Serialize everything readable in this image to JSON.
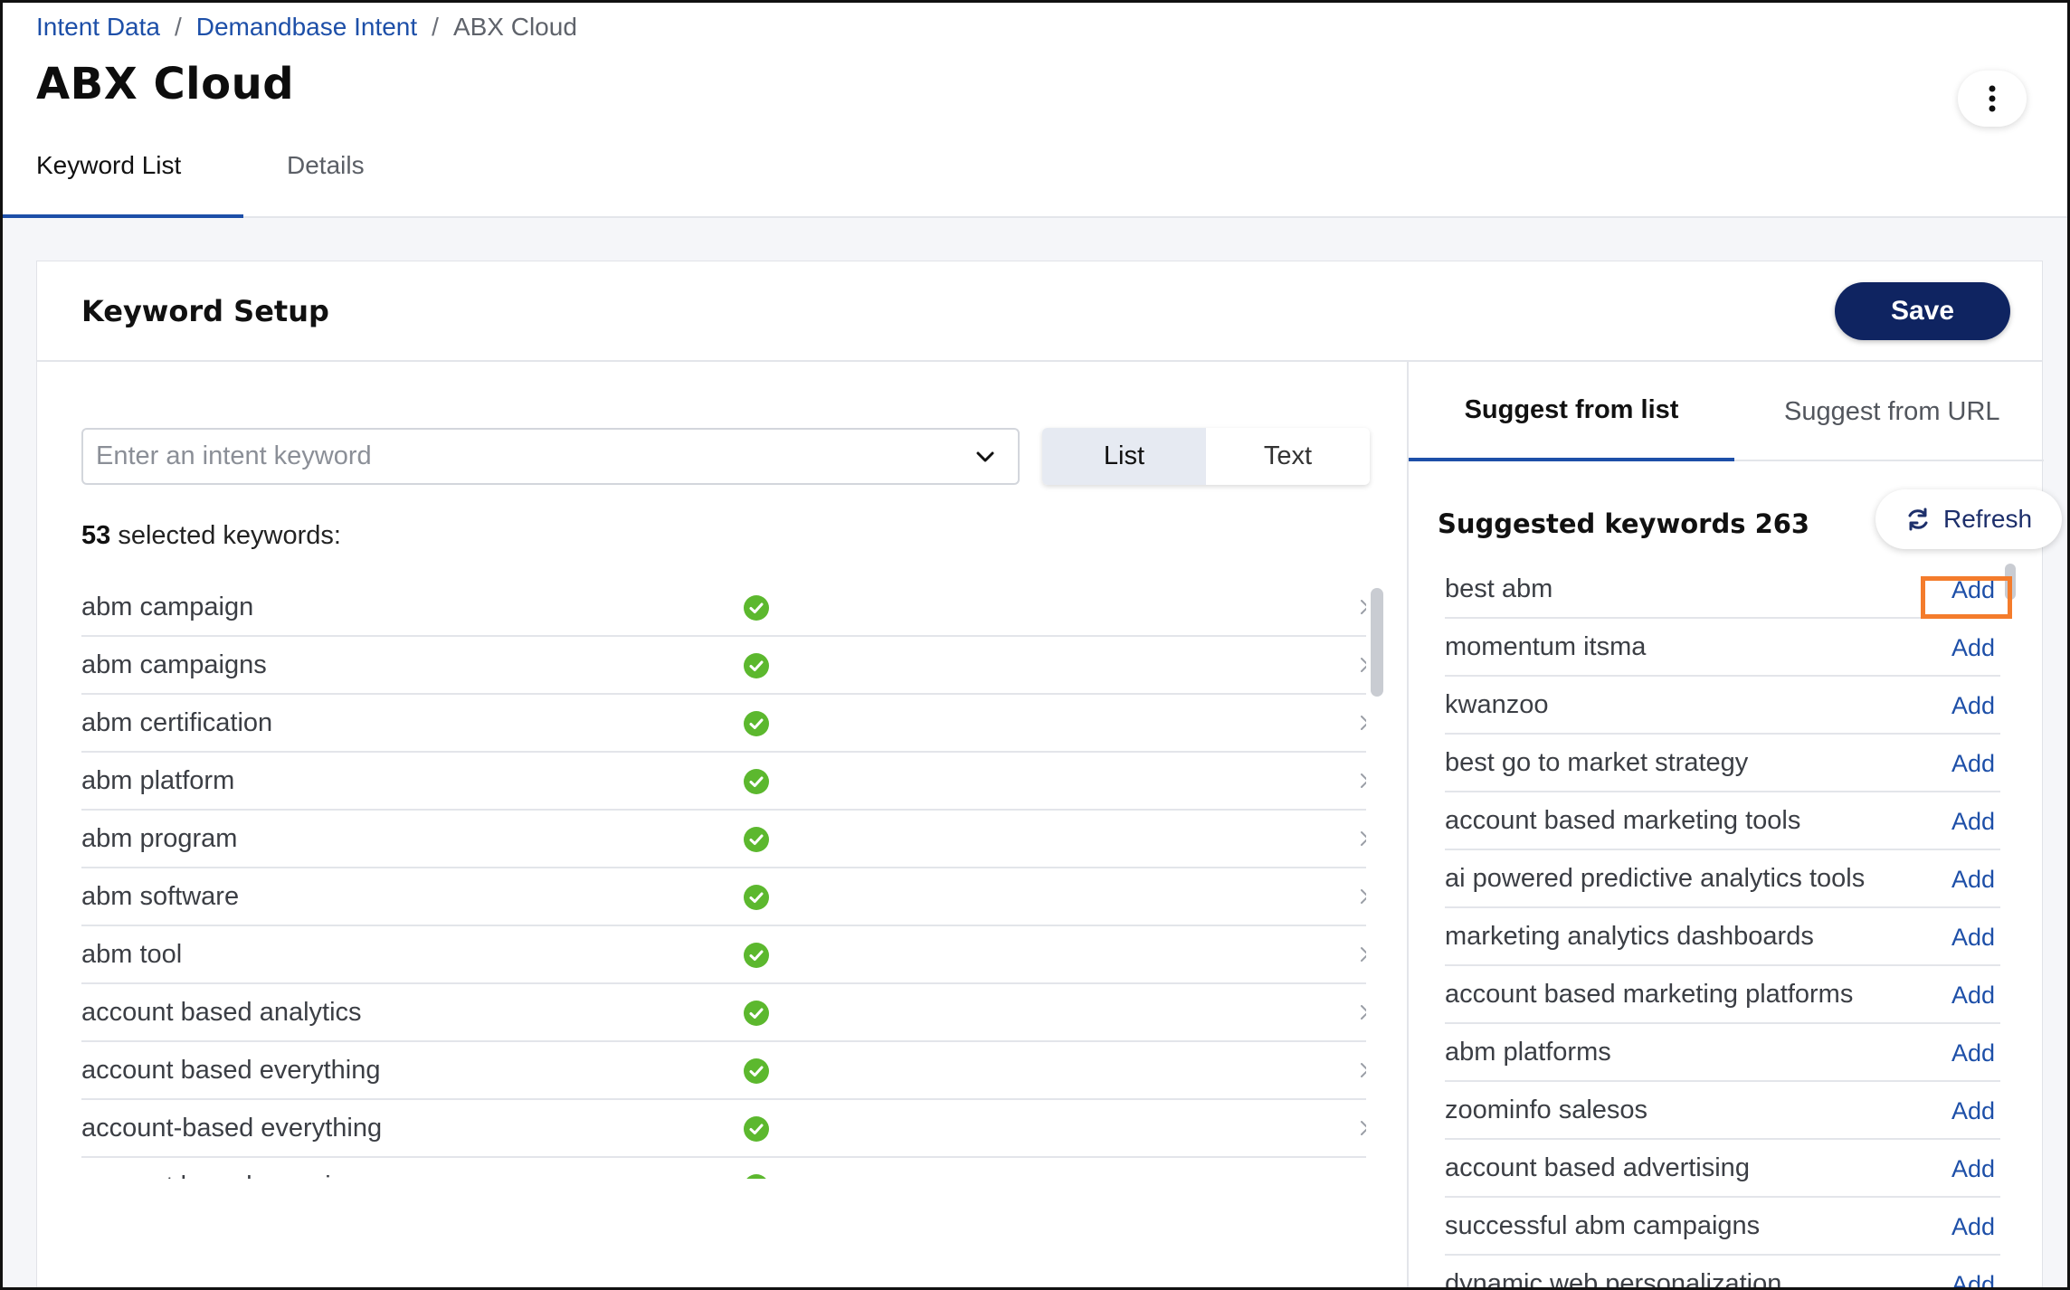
{
  "breadcrumb": {
    "items": [
      "Intent Data",
      "Demandbase Intent"
    ],
    "separator": "/",
    "current": "ABX Cloud"
  },
  "page": {
    "title": "ABX Cloud",
    "tabs": [
      {
        "label": "Keyword List",
        "active": true
      },
      {
        "label": "Details",
        "active": false
      }
    ]
  },
  "card": {
    "title": "Keyword Setup",
    "save_label": "Save"
  },
  "keyword_input": {
    "placeholder": "Enter an intent keyword"
  },
  "view_toggle": {
    "options": [
      "List",
      "Text"
    ],
    "selected": "List"
  },
  "selected": {
    "count": "53",
    "suffix": " selected keywords:",
    "keywords": [
      "abm campaign",
      "abm campaigns",
      "abm certification",
      "abm platform",
      "abm program",
      "abm software",
      "abm tool",
      "account based analytics",
      "account based everything",
      "account-based everything",
      "account based experience"
    ]
  },
  "suggest": {
    "tabs": [
      "Suggest from list",
      "Suggest from URL"
    ],
    "active_tab": "Suggest from list",
    "title": "Suggested keywords 263",
    "refresh_label": "Refresh",
    "add_label": "Add",
    "keywords": [
      "best abm",
      "momentum itsma",
      "kwanzoo",
      "best go to market strategy",
      "account based marketing tools",
      "ai powered predictive analytics tools",
      "marketing analytics dashboards",
      "account based marketing platforms",
      "abm platforms",
      "zoominfo salesos",
      "account based advertising",
      "successful abm campaigns",
      "dynamic web personalization"
    ]
  },
  "colors": {
    "link": "#1d4fa8",
    "primary_button": "#0f2461",
    "check_green": "#5cb82e",
    "highlight": "#f47c2c"
  },
  "icons": {
    "kebab": "more-vertical-icon",
    "dropdown": "chevron-down-icon",
    "valid": "check-circle-icon",
    "remove": "close-icon",
    "refresh": "refresh-icon"
  }
}
